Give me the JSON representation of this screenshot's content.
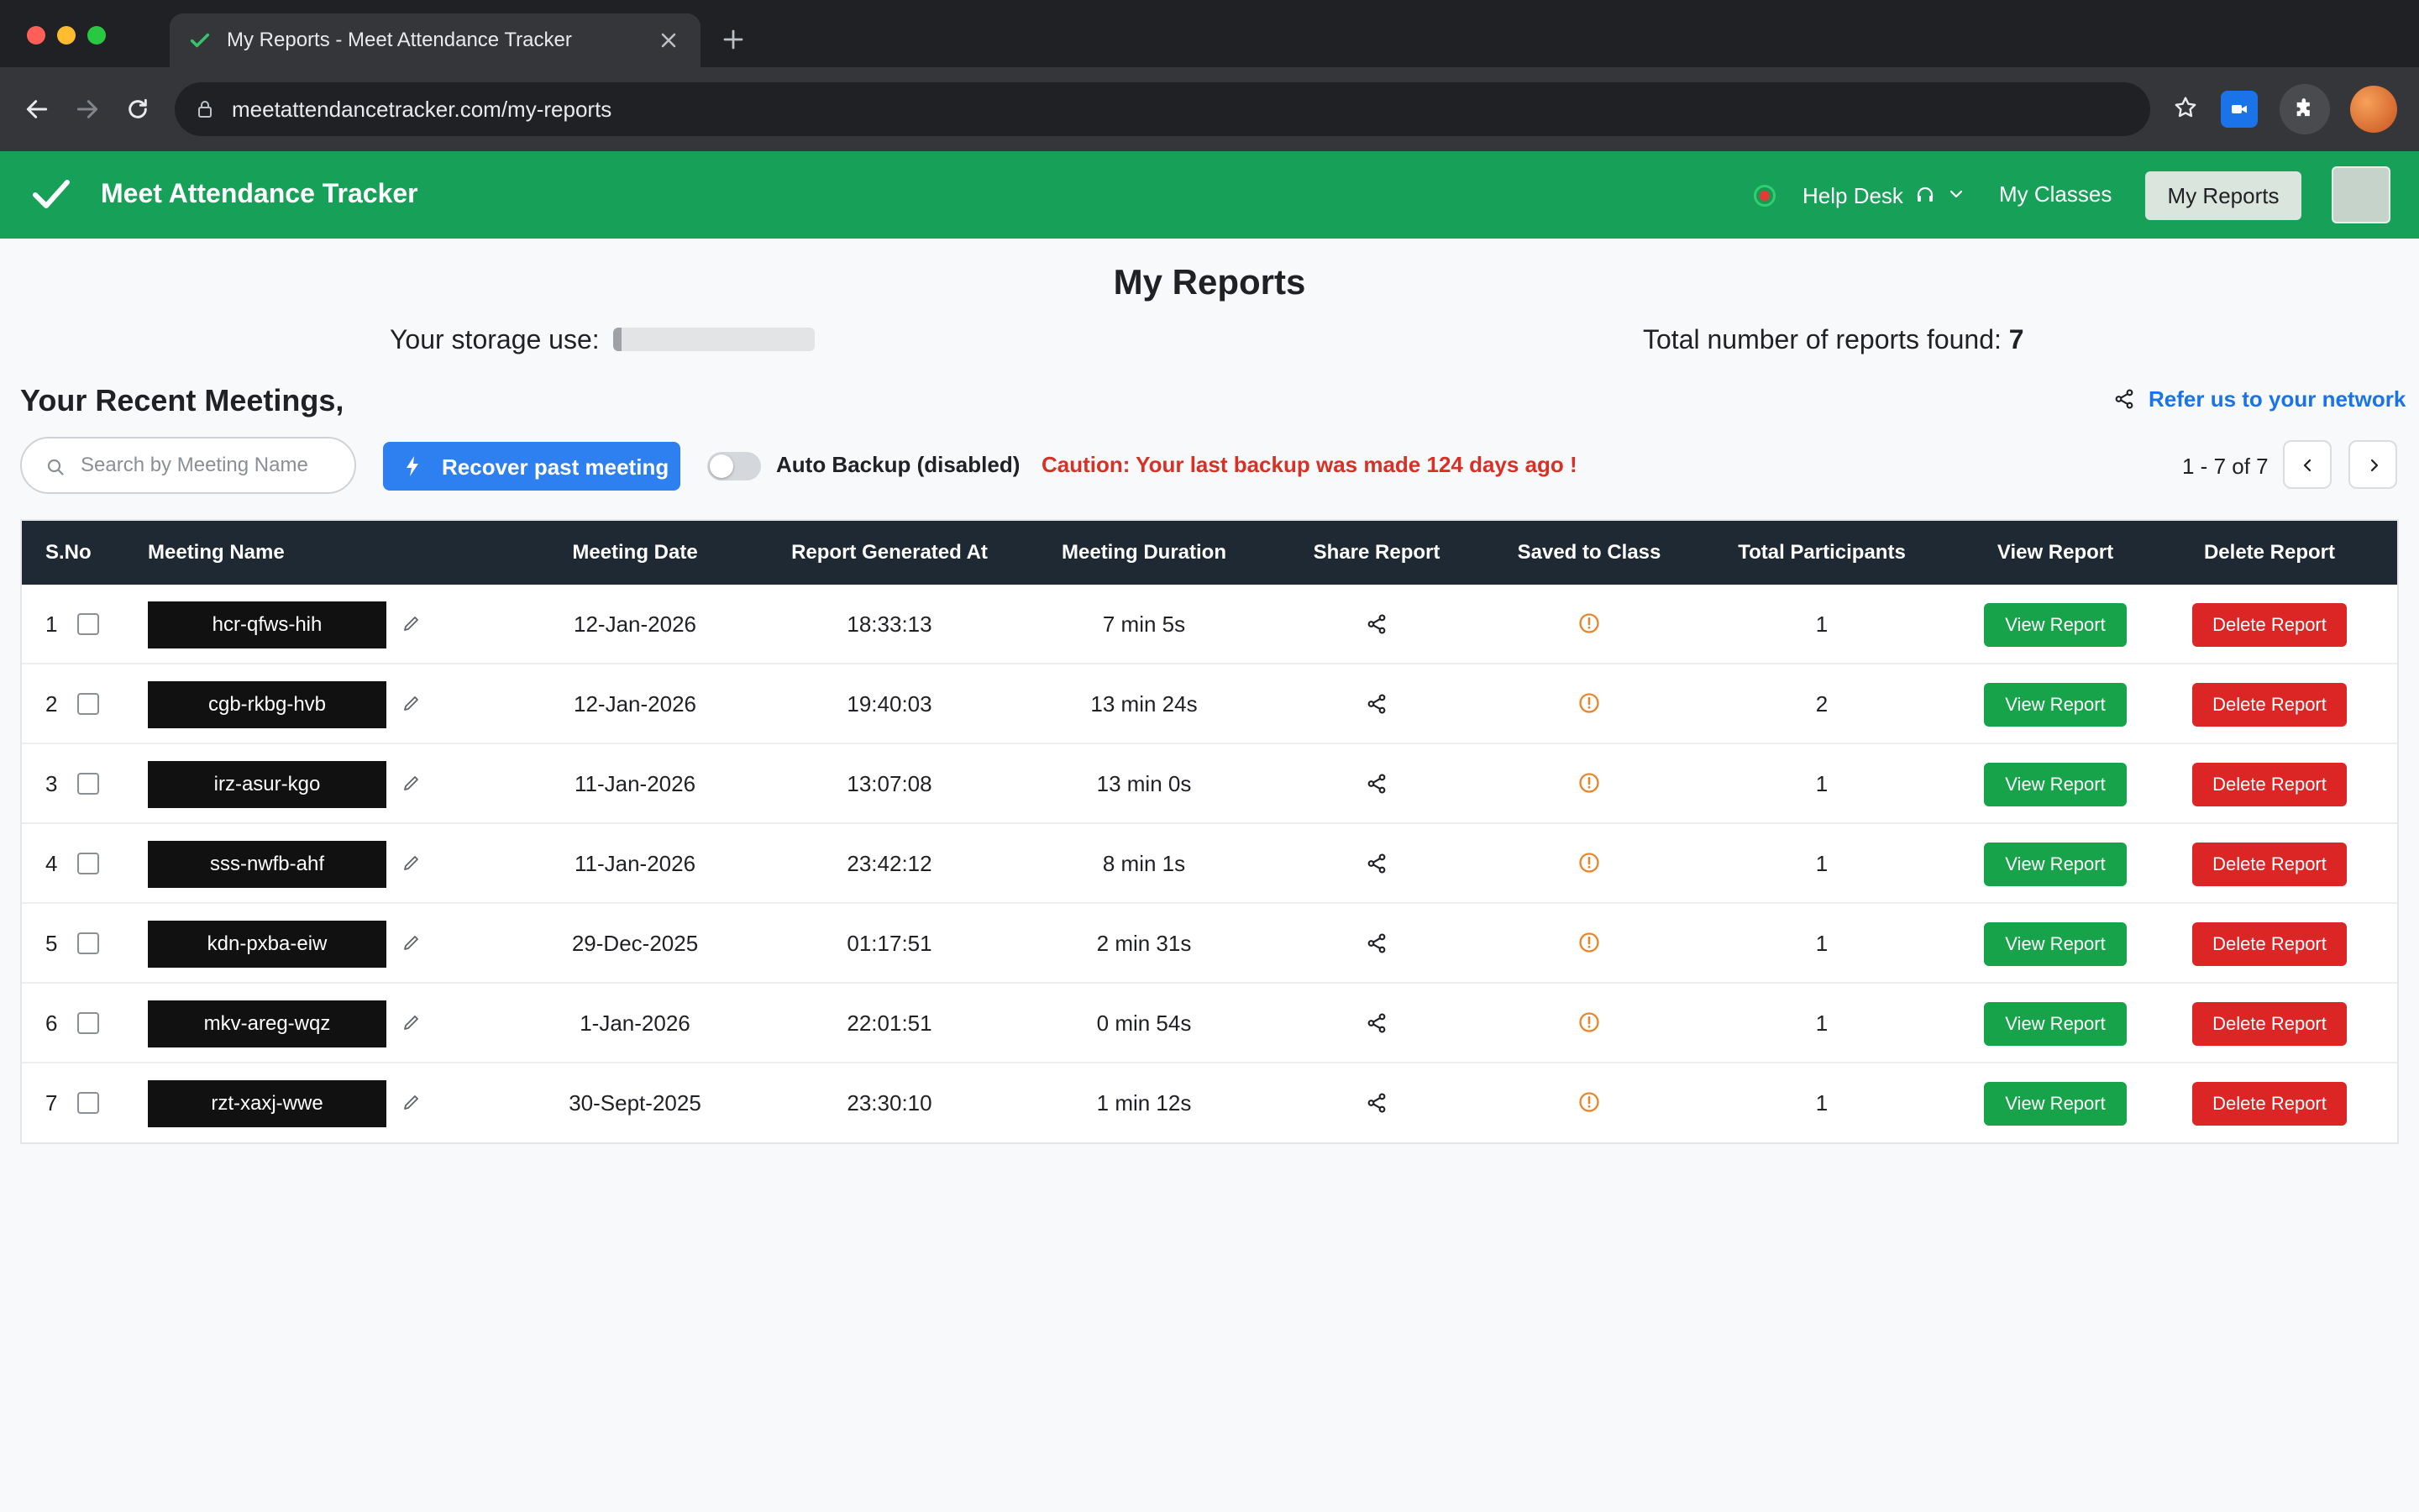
{
  "browser": {
    "tab_title": "My Reports - Meet Attendance Tracker",
    "url": "meetattendancetracker.com/my-reports"
  },
  "header": {
    "brand": "Meet Attendance Tracker",
    "help_desk": "Help Desk",
    "my_classes": "My Classes",
    "my_reports": "My Reports"
  },
  "page": {
    "title": "My Reports",
    "storage_label": "Your storage use:",
    "storage_fraction": 0.04,
    "total_reports_label": "Total number of reports found:",
    "total_reports_count": "7",
    "recent_heading": "Your Recent Meetings,",
    "refer_link": "Refer us to your network"
  },
  "controls": {
    "search_placeholder": "Search by Meeting Name",
    "recover_button": "Recover past meeting",
    "auto_backup_label": "Auto Backup (disabled)",
    "auto_backup_enabled": false,
    "caution": "Caution: Your last backup was made 124 days ago !",
    "pagination": "1 - 7 of 7"
  },
  "table": {
    "columns": [
      "S.No",
      "Meeting Name",
      "Meeting Date",
      "Report Generated At",
      "Meeting Duration",
      "Share Report",
      "Saved to Class",
      "Total Participants",
      "View Report",
      "Delete Report"
    ],
    "view_label": "View Report",
    "delete_label": "Delete Report",
    "rows": [
      {
        "sno": "1",
        "name": "hcr-qfws-hih",
        "date": "12-Jan-2026",
        "generated": "18:33:13",
        "duration": "7 min 5s",
        "participants": "1"
      },
      {
        "sno": "2",
        "name": "cgb-rkbg-hvb",
        "date": "12-Jan-2026",
        "generated": "19:40:03",
        "duration": "13 min 24s",
        "participants": "2"
      },
      {
        "sno": "3",
        "name": "irz-asur-kgo",
        "date": "11-Jan-2026",
        "generated": "13:07:08",
        "duration": "13 min 0s",
        "participants": "1"
      },
      {
        "sno": "4",
        "name": "sss-nwfb-ahf",
        "date": "11-Jan-2026",
        "generated": "23:42:12",
        "duration": "8 min 1s",
        "participants": "1"
      },
      {
        "sno": "5",
        "name": "kdn-pxba-eiw",
        "date": "29-Dec-2025",
        "generated": "01:17:51",
        "duration": "2 min 31s",
        "participants": "1"
      },
      {
        "sno": "6",
        "name": "mkv-areg-wqz",
        "date": "1-Jan-2026",
        "generated": "22:01:51",
        "duration": "0 min 54s",
        "participants": "1"
      },
      {
        "sno": "7",
        "name": "rzt-xaxj-wwe",
        "date": "30-Sept-2025",
        "generated": "23:30:10",
        "duration": "1 min 12s",
        "participants": "1"
      }
    ]
  },
  "colors": {
    "header_green": "#16a058",
    "primary_blue": "#2e7ff0",
    "view_green": "#16a34a",
    "delete_red": "#dc2626",
    "caution_red": "#d93025",
    "warning_orange": "#e8862a",
    "table_header": "#1f2933"
  },
  "icons": [
    "check-icon",
    "close-icon",
    "plus-icon",
    "back-arrow-icon",
    "forward-arrow-icon",
    "reload-icon",
    "lock-icon",
    "star-icon",
    "video-icon",
    "puzzle-icon",
    "headset-icon",
    "chevron-down-icon",
    "share-icon",
    "search-icon",
    "bolt-icon",
    "chevron-left-icon",
    "chevron-right-icon",
    "edit-pencil-icon",
    "warning-circle-icon"
  ]
}
